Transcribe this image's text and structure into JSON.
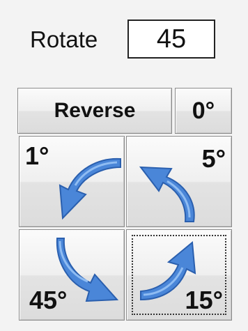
{
  "rotate": {
    "label": "Rotate",
    "value": "45"
  },
  "buttons": {
    "reverse": "Reverse",
    "zero": "0°",
    "rot1": "1°",
    "rot5": "5°",
    "rot45": "45°",
    "rot15": "15°"
  },
  "icons": {
    "rot1": "curved-arrow-ccw-icon",
    "rot5": "curved-arrow-ccw-icon",
    "rot45": "curved-arrow-cw-icon",
    "rot15": "curved-arrow-cw-icon"
  },
  "colors": {
    "arrow": "#4a86d8",
    "arrow_dark": "#2a5fae",
    "arrow_light": "#7fb0ee"
  }
}
